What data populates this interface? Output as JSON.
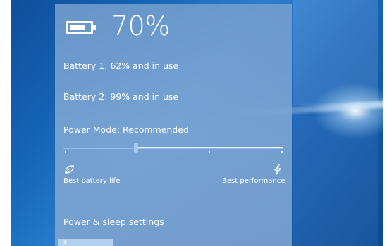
{
  "battery": {
    "percent_text": "70%",
    "level": 0.7,
    "lines": [
      "Battery 1: 62% and in use",
      "Battery 2: 99% and in use"
    ]
  },
  "power_mode": {
    "label": "Power Mode: Recommended",
    "slider_value": 0.33,
    "left_label": "Best battery life",
    "right_label": "Best performance",
    "left_icon": "leaf-icon",
    "right_icon": "lightning-icon"
  },
  "link": {
    "label": "Power & sleep settings"
  },
  "quick_action": {
    "icon": "brightness-icon"
  }
}
